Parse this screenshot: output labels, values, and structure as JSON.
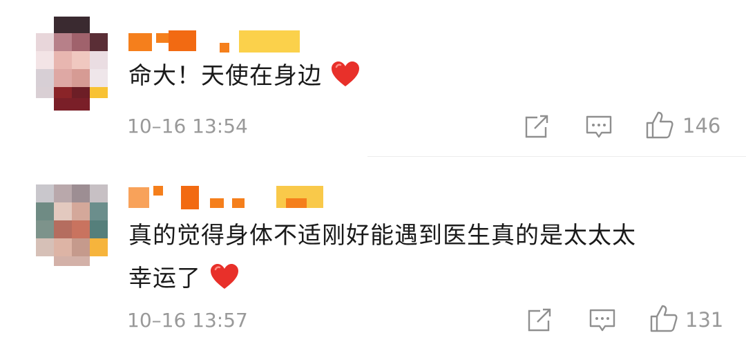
{
  "comments": [
    {
      "text": "命大！天使在身边",
      "timestamp": "10–16 13:54",
      "like_count": "146",
      "icons": [
        "share-icon",
        "comment-icon",
        "like-icon"
      ],
      "emoji": "red-heart-icon"
    },
    {
      "text_line1": "真的觉得身体不适刚好能遇到医生真的是太太太",
      "text_line2": "幸运了",
      "timestamp": "10–16 13:57",
      "like_count": "131",
      "icons": [
        "share-icon",
        "comment-icon",
        "like-icon"
      ],
      "emoji": "red-heart-icon"
    }
  ],
  "colors": {
    "text": "#1a1a1a",
    "meta": "#999999",
    "heart": "#e8302a",
    "name_orange": "#f57f1c",
    "name_yellow": "#fbd14b"
  }
}
